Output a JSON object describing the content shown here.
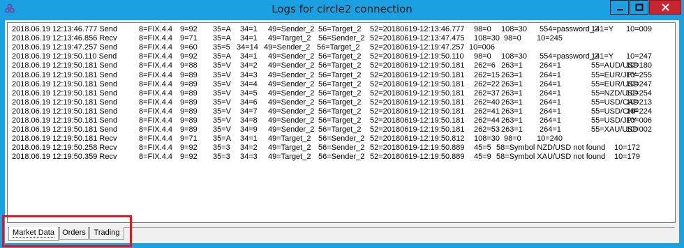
{
  "window": {
    "title": "Logs for circle2 connection",
    "icon": "circle-logo-icon",
    "colors": {
      "frame": "#1ba1e2",
      "close": "#c7262e",
      "highlight": "#e8131b"
    }
  },
  "log_rows": [
    [
      "2018.06.19 12:13:46.777 Send",
      "8=FIX.4.4",
      "9=92",
      "35=A",
      "34=1",
      "49=Sender_2",
      "56=Target_2",
      "52=20180619-12:13:46.777",
      "98=0",
      "108=30",
      "554=password_2",
      "141=Y",
      "10=009"
    ],
    [
      "2018.06.19 12:13:46.856 Recv",
      "8=FIX.4.4",
      "9=71",
      "35=A",
      "34=1",
      "49=Target_2",
      "56=Sender_2",
      "52=20180619-12:13:47.475",
      "108=30",
      "98=0",
      "10=245",
      "",
      ""
    ],
    [
      "2018.06.19 12:19:47.257 Send",
      "8=FIX.4.4",
      "9=60",
      "35=5",
      "34=14",
      "49=Sender_2",
      "56=Target_2",
      "52=20180619-12:19:47.257",
      "10=006",
      "",
      "",
      "",
      ""
    ],
    [
      "2018.06.19 12:19:50.110 Send",
      "8=FIX.4.4",
      "9=92",
      "35=A",
      "34=1",
      "49=Sender_2",
      "56=Target_2",
      "52=20180619-12:19:50.110",
      "98=0",
      "108=30",
      "554=password_2",
      "141=Y",
      "10=247"
    ],
    [
      "2018.06.19 12:19:50.181 Send",
      "8=FIX.4.4",
      "9=88",
      "35=V",
      "34=2",
      "49=Sender_2",
      "56=Target_2",
      "52=20180619-12:19:50.181",
      "262=6",
      "263=1",
      "264=1",
      "55=AUD/USD",
      "10=180"
    ],
    [
      "2018.06.19 12:19:50.181 Send",
      "8=FIX.4.4",
      "9=89",
      "35=V",
      "34=3",
      "49=Sender_2",
      "56=Target_2",
      "52=20180619-12:19:50.181",
      "262=15",
      "263=1",
      "264=1",
      "55=EUR/JPY",
      "10=255"
    ],
    [
      "2018.06.19 12:19:50.181 Send",
      "8=FIX.4.4",
      "9=89",
      "35=V",
      "34=4",
      "49=Sender_2",
      "56=Target_2",
      "52=20180619-12:19:50.181",
      "262=22",
      "263=1",
      "264=1",
      "55=EUR/USD",
      "10=247"
    ],
    [
      "2018.06.19 12:19:50.181 Send",
      "8=FIX.4.4",
      "9=89",
      "35=V",
      "34=5",
      "49=Sender_2",
      "56=Target_2",
      "52=20180619-12:19:50.181",
      "262=37",
      "263=1",
      "264=1",
      "55=NZD/USD",
      "10=254"
    ],
    [
      "2018.06.19 12:19:50.181 Send",
      "8=FIX.4.4",
      "9=89",
      "35=V",
      "34=6",
      "49=Sender_2",
      "56=Target_2",
      "52=20180619-12:19:50.181",
      "262=40",
      "263=1",
      "264=1",
      "55=USD/CAD",
      "10=213"
    ],
    [
      "2018.06.19 12:19:50.181 Send",
      "8=FIX.4.4",
      "9=89",
      "35=V",
      "34=7",
      "49=Sender_2",
      "56=Target_2",
      "52=20180619-12:19:50.181",
      "262=41",
      "263=1",
      "264=1",
      "55=USD/CHF",
      "10=224"
    ],
    [
      "2018.06.19 12:19:50.181 Send",
      "8=FIX.4.4",
      "9=89",
      "35=V",
      "34=8",
      "49=Sender_2",
      "56=Target_2",
      "52=20180619-12:19:50.181",
      "262=44",
      "263=1",
      "264=1",
      "55=USD/JPY",
      "10=006"
    ],
    [
      "2018.06.19 12:19:50.181 Send",
      "8=FIX.4.4",
      "9=89",
      "35=V",
      "34=9",
      "49=Sender_2",
      "56=Target_2",
      "52=20180619-12:19:50.181",
      "262=53",
      "263=1",
      "264=1",
      "55=XAU/USD",
      "10=002"
    ],
    [
      "2018.06.19 12:19:50.181 Recv",
      "8=FIX.4.4",
      "9=71",
      "35=A",
      "34=1",
      "49=Target_2",
      "56=Sender_2",
      "52=20180619-12:19:50.812",
      "108=30",
      "98=0",
      "10=240",
      "",
      ""
    ],
    [
      "2018.06.19 12:19:50.258 Recv",
      "8=FIX.4.4",
      "9=92",
      "35=3",
      "34=2",
      "49=Target_2",
      "56=Sender_2",
      "52=20180619-12:19:50.889",
      "45=5",
      "58=Symbol NZD/USD not found",
      "10=172",
      "",
      ""
    ],
    [
      "2018.06.19 12:19:50.359 Recv",
      "8=FIX.4.4",
      "9=92",
      "35=3",
      "34=3",
      "49=Target_2",
      "56=Sender_2",
      "52=20180619-12:19:50.889",
      "45=9",
      "58=Symbol XAU/USD not found",
      "10=179",
      "",
      ""
    ]
  ],
  "tabs": [
    {
      "label": "Market Data",
      "active": true
    },
    {
      "label": "Orders",
      "active": false
    },
    {
      "label": "Trading",
      "active": false
    }
  ]
}
